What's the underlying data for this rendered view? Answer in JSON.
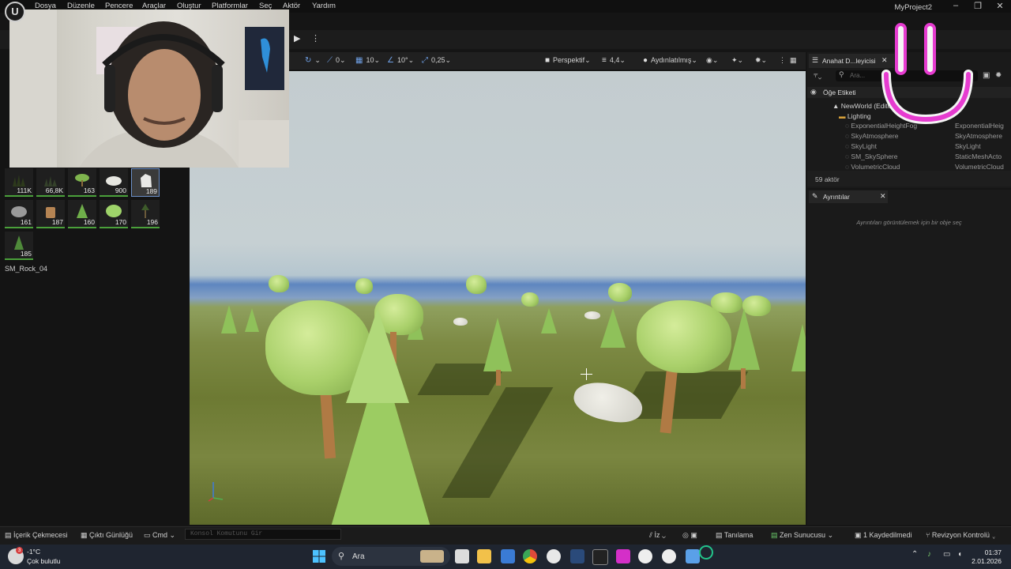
{
  "menu": {
    "items": [
      "Dosya",
      "Düzenle",
      "Pencere",
      "Araçlar",
      "Oluştur",
      "Platformlar",
      "Seç",
      "Aktör",
      "Yardım"
    ],
    "project_name": "MyProject2"
  },
  "viewport_toolbar": {
    "rotation_snap": "0",
    "grid_snap": "10",
    "angle_snap": "10°",
    "scale_snap": "0,25",
    "view_mode": "Perspektif",
    "speed": "4,4",
    "lighting": "Aydınlatılmış"
  },
  "assets": [
    {
      "count": "111K",
      "icon": "grass-icon"
    },
    {
      "count": "66,8K",
      "icon": "grass-icon"
    },
    {
      "count": "163",
      "icon": "bush-icon"
    },
    {
      "count": "900",
      "icon": "rock-icon"
    },
    {
      "count": "189",
      "icon": "rock-icon"
    },
    {
      "count": "161",
      "icon": "rock-icon"
    },
    {
      "count": "187",
      "icon": "stump-icon"
    },
    {
      "count": "160",
      "icon": "pine-icon"
    },
    {
      "count": "170",
      "icon": "bush-icon"
    },
    {
      "count": "196",
      "icon": "tree-icon"
    },
    {
      "count": "185",
      "icon": "pine-icon"
    }
  ],
  "selected_asset_name": "SM_Rock_04",
  "outliner": {
    "tab_title": "Anahat D...leyicisi",
    "search_placeholder": "Ara...",
    "column_label": "Öğe Etiketi",
    "world": "NewWorld (Editor)",
    "folder": "Lighting",
    "rows": [
      {
        "label": "ExponentialHeightFog",
        "type": "ExponentialHeig"
      },
      {
        "label": "SkyAtmosphere",
        "type": "SkyAtmosphere"
      },
      {
        "label": "SkyLight",
        "type": "SkyLight"
      },
      {
        "label": "SM_SkySphere",
        "type": "StaticMeshActo"
      },
      {
        "label": "VolumetricCloud",
        "type": "VolumetricCloud"
      }
    ],
    "actor_count": "59 aktör"
  },
  "details": {
    "tab_title": "Ayrıntılar",
    "hint": "Ayrıntıları görüntülemek için bir obje seç"
  },
  "status_bar": {
    "content_drawer": "İçerik Çekmecesi",
    "output_log": "Çıktı Günlüğü",
    "cmd": "Cmd",
    "console_placeholder": "Konsol Komutunu Gir",
    "trace": "İz",
    "derive": "Tanılama",
    "zen_server": "Zen Sunucusu",
    "unsaved": "1 Kaydedilmedi",
    "revision": "Revizyon Kontrolü"
  },
  "taskbar": {
    "weather_temp": "-1°C",
    "weather_desc": "Çok bulutlu",
    "weather_badge": "3",
    "search_label": "Ara",
    "time": "01:37",
    "date": "2.01.2026"
  }
}
